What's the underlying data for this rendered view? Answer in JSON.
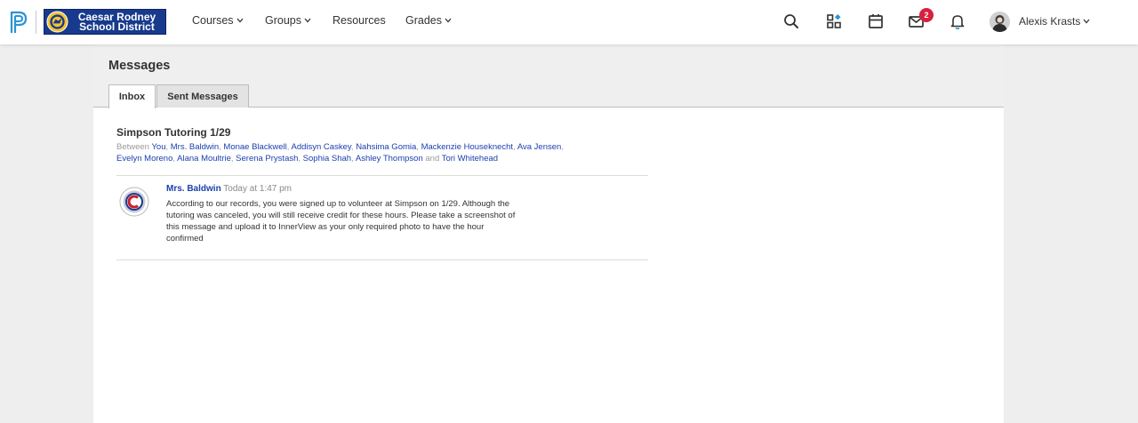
{
  "header": {
    "district_line1": "Caesar Rodney",
    "district_line2": "School District",
    "nav": [
      "Courses",
      "Groups",
      "Resources",
      "Grades"
    ],
    "messages_badge": "2",
    "user_name": "Alexis Krasts",
    "icons": [
      "search-icon",
      "apps-icon",
      "calendar-icon",
      "mail-icon",
      "bell-icon"
    ]
  },
  "page": {
    "title": "Messages",
    "tabs": [
      "Inbox",
      "Sent Messages"
    ],
    "active_tab": "Inbox"
  },
  "thread": {
    "title": "Simpson Tutoring 1/29",
    "between_label": "Between",
    "and_label": "and",
    "participants": [
      "You",
      "Mrs. Baldwin",
      "Monae Blackwell",
      "Addisyn Caskey",
      "Nahsima Gomia",
      "Mackenzie Houseknecht",
      "Ava Jensen",
      "Evelyn Moreno",
      "Alana Moultrie",
      "Serena Prystash",
      "Sophia Shah",
      "Ashley Thompson",
      "Tori Whitehead"
    ]
  },
  "message": {
    "author": "Mrs. Baldwin",
    "time": "Today at 1:47 pm",
    "body_lines": [
      "According to our records, you were signed up to volunteer at Simpson on 1/29. Although the",
      "tutoring was canceled, you will still receive credit for these hours. Please take a screenshot of",
      "this message and upload it to InnerView as your only required photo to have the hour",
      "confirmed"
    ]
  },
  "colors": {
    "link": "#1b3fae",
    "badge": "#d8203f",
    "district_blue": "#173a8c",
    "schoology_blue": "#2a95d3"
  }
}
